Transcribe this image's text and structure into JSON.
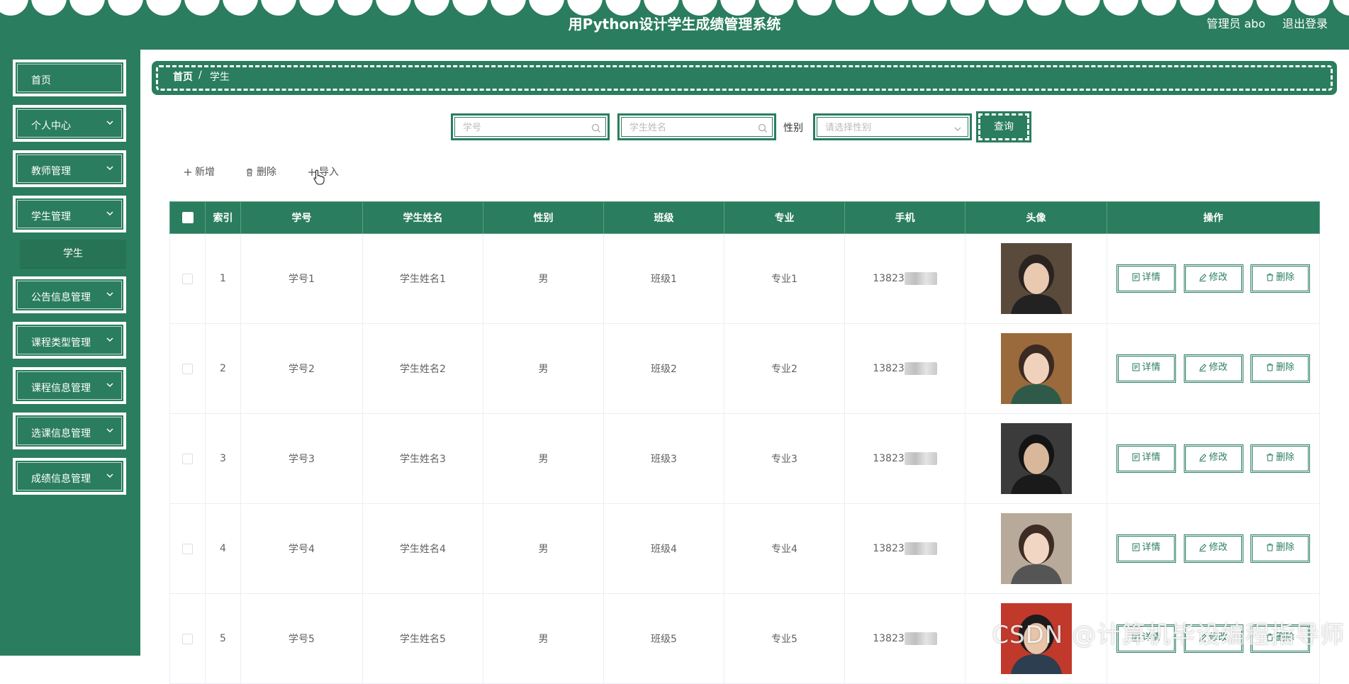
{
  "header": {
    "title": "用Python设计学生成绩管理系统",
    "user": "管理员 abo",
    "logout": "退出登录"
  },
  "sidebar": {
    "items": [
      {
        "label": "首页",
        "has_chevron": false
      },
      {
        "label": "个人中心",
        "has_chevron": true
      },
      {
        "label": "教师管理",
        "has_chevron": true
      },
      {
        "label": "学生管理",
        "has_chevron": true
      },
      {
        "label": "公告信息管理",
        "has_chevron": true
      },
      {
        "label": "课程类型管理",
        "has_chevron": true
      },
      {
        "label": "课程信息管理",
        "has_chevron": true
      },
      {
        "label": "选课信息管理",
        "has_chevron": true
      },
      {
        "label": "成绩信息管理",
        "has_chevron": true
      }
    ],
    "sub_items": [
      {
        "label": "学生"
      }
    ]
  },
  "breadcrumb": {
    "home": "首页",
    "separator": "/",
    "current": "学生"
  },
  "search": {
    "student_no_placeholder": "学号",
    "student_name_placeholder": "学生姓名",
    "gender_label": "性别",
    "gender_placeholder": "请选择性别",
    "query_label": "查询"
  },
  "toolbar": {
    "add_label": "新增",
    "delete_label": "删除",
    "import_label": "导入"
  },
  "table": {
    "headers": [
      "索引",
      "学号",
      "学生姓名",
      "性别",
      "班级",
      "专业",
      "手机",
      "头像",
      "操作"
    ],
    "rows": [
      {
        "index": "1",
        "no": "学号1",
        "name": "学生姓名1",
        "gender": "男",
        "class": "班级1",
        "major": "专业1",
        "phone": "13823"
      },
      {
        "index": "2",
        "no": "学号2",
        "name": "学生姓名2",
        "gender": "男",
        "class": "班级2",
        "major": "专业2",
        "phone": "13823"
      },
      {
        "index": "3",
        "no": "学号3",
        "name": "学生姓名3",
        "gender": "男",
        "class": "班级3",
        "major": "专业3",
        "phone": "13823"
      },
      {
        "index": "4",
        "no": "学号4",
        "name": "学生姓名4",
        "gender": "男",
        "class": "班级4",
        "major": "专业4",
        "phone": "13823"
      },
      {
        "index": "5",
        "no": "学号5",
        "name": "学生姓名5",
        "gender": "男",
        "class": "班级5",
        "major": "专业5",
        "phone": "13823"
      }
    ],
    "actions": {
      "detail": "详情",
      "edit": "修改",
      "delete": "删除"
    }
  },
  "watermark": "CSDN @计算机毕设编程指导师",
  "colors": {
    "primary": "#2a7d5e",
    "white": "#ffffff"
  }
}
